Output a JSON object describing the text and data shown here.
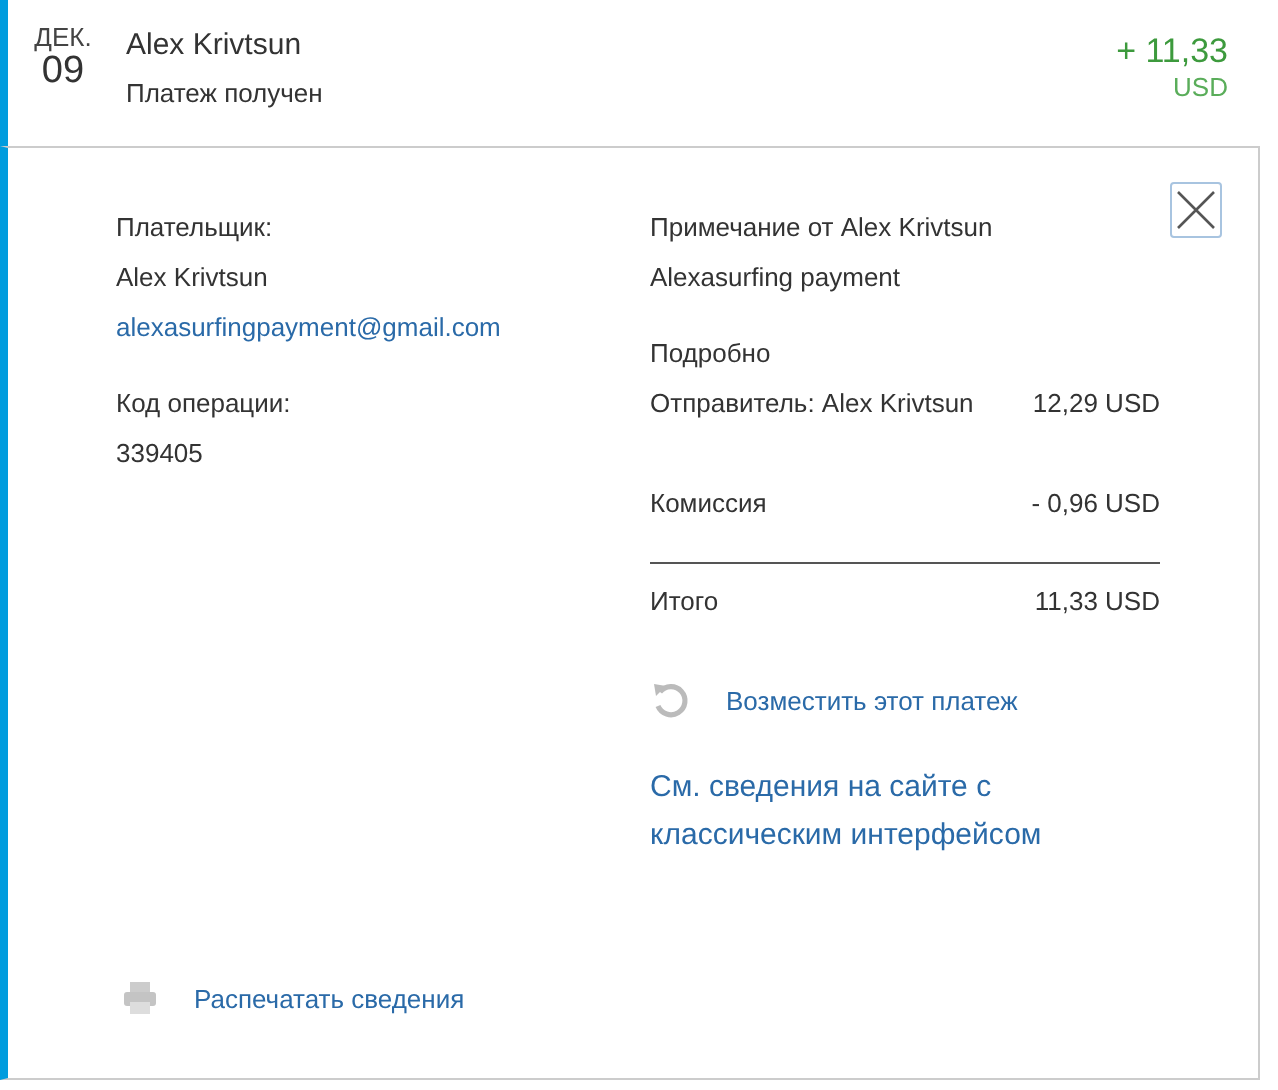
{
  "header": {
    "month": "ДЕК.",
    "day": "09",
    "name": "Alex Krivtsun",
    "status": "Платеж получен",
    "amount": "+ 11,33",
    "currency": "USD",
    "selected": true
  },
  "payer": {
    "label": "Плательщик:",
    "name": "Alex Krivtsun",
    "email": "alexasurfingpayment@gmail.com"
  },
  "operation": {
    "label": "Код операции:",
    "code": "339405"
  },
  "note": {
    "label": "Примечание от Alex Krivtsun",
    "text": "Alexasurfing payment"
  },
  "details": {
    "title": "Подробно",
    "rows": [
      {
        "label": "Отправитель: Alex Krivtsun",
        "value": "12,29 USD",
        "kind": "item"
      },
      {
        "label": "Комиссия",
        "value": "- 0,96 USD",
        "kind": "item"
      },
      {
        "label": "Итого",
        "value": "11,33 USD",
        "kind": "total"
      }
    ]
  },
  "refund_link": "Возместить этот платеж",
  "classic_link": "См. сведения на сайте с классическим интерфейсом",
  "print_link": "Распечатать сведения"
}
